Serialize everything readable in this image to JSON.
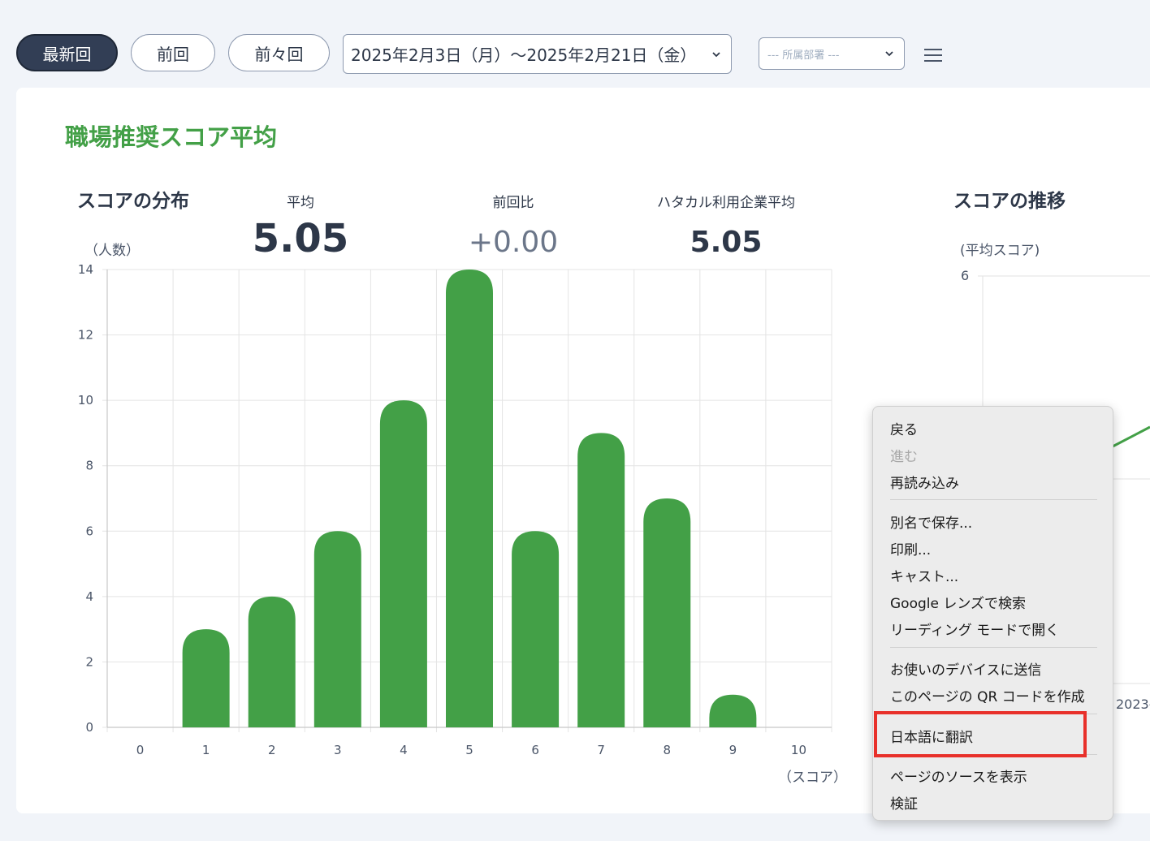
{
  "toolbar": {
    "latest": "最新回",
    "previous": "前回",
    "before_previous": "前々回",
    "date_range": "2025年2月3日（月）〜2025年2月21日（金）",
    "department_placeholder": "--- 所属部署 ---"
  },
  "card": {
    "title": "職場推奨スコア平均"
  },
  "distribution": {
    "title": "スコアの分布",
    "y_unit": "（人数）",
    "x_unit": "（スコア）"
  },
  "stats": {
    "average_label": "平均",
    "average_value": "5.05",
    "change_label": "前回比",
    "change_value": "+0.00",
    "company_avg_label": "ハタカル利用企業平均",
    "company_avg_value": "5.05"
  },
  "trend": {
    "title": "スコアの推移",
    "y_unit": "(平均スコア)",
    "y_tick_top": "6",
    "x_tick_peek": "2023-"
  },
  "colors": {
    "bar": "#43a047",
    "title_green": "#43a047",
    "active_pill": "#323e55",
    "highlight": "#e8302a"
  },
  "chart_data": {
    "type": "bar",
    "categories": [
      "0",
      "1",
      "2",
      "3",
      "4",
      "5",
      "6",
      "7",
      "8",
      "9",
      "10"
    ],
    "values": [
      0,
      3,
      4,
      6,
      10,
      14,
      6,
      9,
      7,
      1,
      0
    ],
    "ylim": [
      0,
      14
    ],
    "yticks": [
      "0",
      "2",
      "4",
      "6",
      "8",
      "10",
      "12",
      "14"
    ],
    "xlabel": "（スコア）",
    "ylabel": "（人数）",
    "grid": true
  },
  "context_menu": {
    "back": "戻る",
    "forward": "進む",
    "reload": "再読み込み",
    "save_as": "別名で保存...",
    "print": "印刷...",
    "cast": "キャスト...",
    "lens": "Google レンズで検索",
    "reading_mode": "リーディング モードで開く",
    "send_to_device": "お使いのデバイスに送信",
    "qr_code": "このページの QR コードを作成",
    "translate": "日本語に翻訳",
    "view_source": "ページのソースを表示",
    "inspect": "検証"
  }
}
